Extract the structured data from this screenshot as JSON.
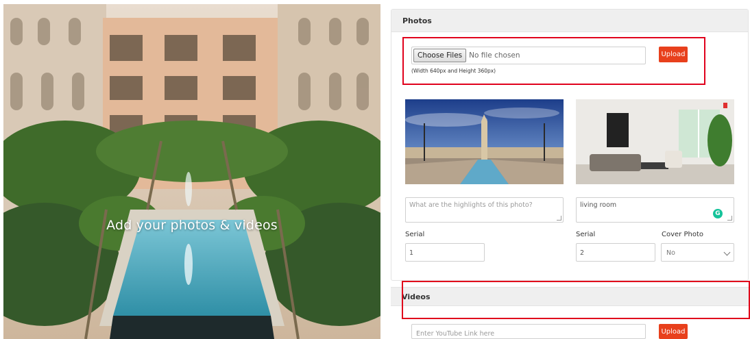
{
  "hero": {
    "caption": "Add your photos & videos"
  },
  "photos": {
    "title": "Photos",
    "choose_files_label": "Choose Files",
    "file_status": "No file chosen",
    "size_hint": "(Width 640px and Height 360px)",
    "upload_label": "Upload",
    "items": [
      {
        "description_placeholder": "What are the highlights of this photo?",
        "description_value": "",
        "serial_label": "Serial",
        "serial_value": "1"
      },
      {
        "description_placeholder": "",
        "description_value": "living room",
        "serial_label": "Serial",
        "serial_value": "2",
        "cover_label": "Cover Photo",
        "cover_value": "No"
      }
    ]
  },
  "videos": {
    "title": "Videos",
    "link_placeholder": "Enter YouTube Link here",
    "upload_label": "Upload"
  },
  "colors": {
    "accent": "#e8401c",
    "highlight_frame": "#e0001b",
    "grammarly": "#15c39a"
  },
  "icons": {
    "grammarly": "G"
  }
}
